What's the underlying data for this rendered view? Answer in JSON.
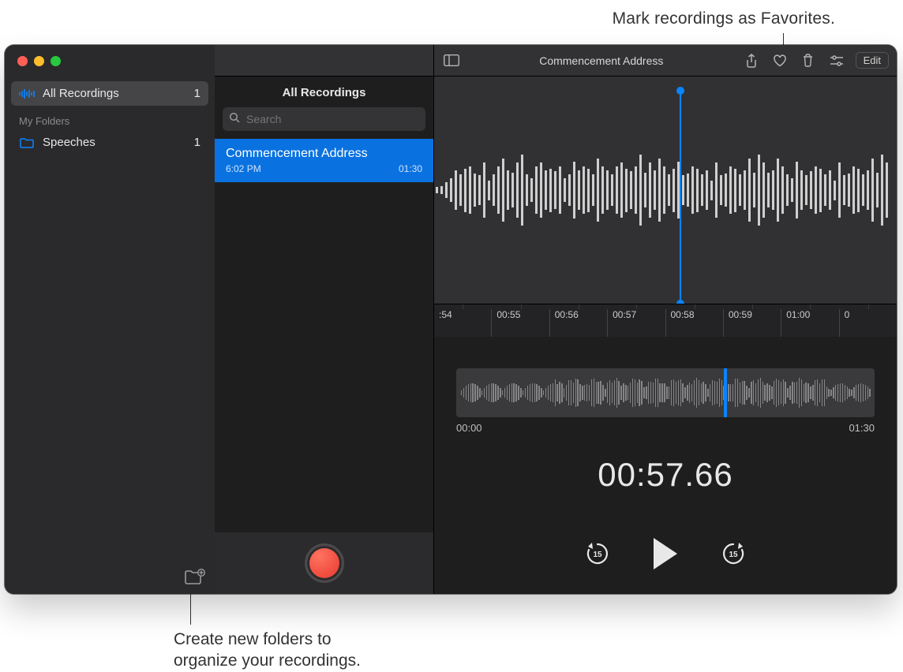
{
  "callouts": {
    "favorite": "Mark recordings as Favorites.",
    "new_folder": "Create new folders to\norganize your recordings."
  },
  "sidebar": {
    "items": [
      {
        "label": "All Recordings",
        "count": "1"
      }
    ],
    "folders_header": "My Folders",
    "folders": [
      {
        "label": "Speeches",
        "count": "1"
      }
    ]
  },
  "middle": {
    "header": "All Recordings",
    "search_placeholder": "Search",
    "recordings": [
      {
        "title": "Commencement Address",
        "time": "6:02 PM",
        "duration": "01:30"
      }
    ]
  },
  "toolbar": {
    "title": "Commencement Address",
    "edit_label": "Edit"
  },
  "detail": {
    "ruler_ticks": [
      ":54",
      "00:55",
      "00:56",
      "00:57",
      "00:58",
      "00:59",
      "01:00",
      "0"
    ],
    "overview_start": "00:00",
    "overview_end": "01:30",
    "current_time": "00:57.66",
    "skip_seconds": "15"
  }
}
